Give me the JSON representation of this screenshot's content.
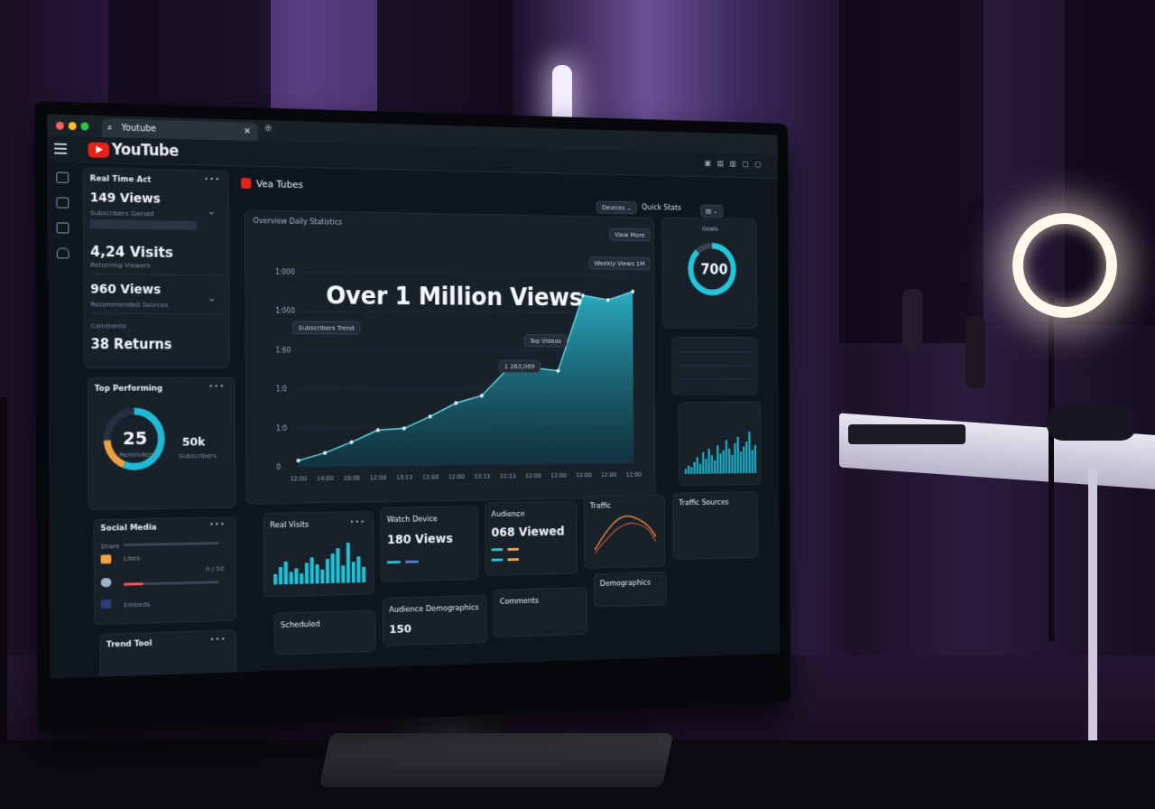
{
  "browser": {
    "tab_title": "Youtube",
    "tab_close": "✕"
  },
  "header": {
    "logo_text": "YouTube"
  },
  "left_panel": {
    "title": "Real Time Act",
    "stats": [
      {
        "value": "149 Views",
        "caption": "Subscribers Gained"
      },
      {
        "value": "4,24 Visits",
        "caption": "Returning Viewers"
      },
      {
        "value": "960 Views",
        "caption": "Recommended Sources"
      },
      {
        "value": "38 Returns",
        "caption": "Comments"
      }
    ]
  },
  "top_performing": {
    "title": "Top Performing",
    "gauge_value": "25",
    "gauge_caption": "Reminders",
    "side_value": "50k",
    "side_caption": "Subscribers",
    "gauge_fraction": 0.72
  },
  "social_panel": {
    "title": "Social Media",
    "items": [
      "Share",
      "Likes",
      "Embeds"
    ],
    "value": "0 / 50"
  },
  "trend_panel": {
    "title": "Trend Tool"
  },
  "main": {
    "title": "Vea Tubes",
    "dropdown_label": "Devices",
    "top_right_label": "Quick Stats",
    "chart_header": "Overview Daily Statistics",
    "chart_button": "View More",
    "headline": "Over 1 Million Views",
    "tooltips": {
      "peak": "Weekly Views 1M",
      "mid": "Top Videos",
      "point": "1 263,069",
      "left": "Subscribers Trend"
    }
  },
  "ring_panel": {
    "label": "Goals",
    "value": "700",
    "fraction": 0.88
  },
  "bottom_cards": {
    "real_time": {
      "title": "Real Visits"
    },
    "watch_time": {
      "title": "Watch Device",
      "value": "180 Views"
    },
    "audience": {
      "title": "Audience",
      "value": "068 Viewed"
    },
    "traffic": {
      "title": "Traffic"
    },
    "demographics": {
      "title": "Demographics"
    },
    "audience_chip": {
      "title": "Audience Demographics",
      "value": "150"
    },
    "scheduled": {
      "title": "Scheduled"
    },
    "comments": {
      "title": "Comments"
    },
    "right_table": {
      "title": "Traffic Sources"
    }
  },
  "chart_data": {
    "type": "area",
    "title": "Over 1 Million Views",
    "x": [
      "12:00",
      "14:00",
      "10:00",
      "12:00",
      "13:13",
      "12:00",
      "12:00",
      "13:13",
      "12:13",
      "12:00",
      "12:00",
      "12:00",
      "12:00",
      "12:00"
    ],
    "y_ticks": [
      "0",
      "1:0",
      "1:0",
      "1:60",
      "1:000",
      "1:000"
    ],
    "series": [
      {
        "values": [
          40,
          90,
          160,
          240,
          250,
          330,
          420,
          470,
          650,
          660,
          640,
          1160,
          1130,
          1190
        ]
      }
    ],
    "ylim": [
      0,
      1300
    ],
    "color": "#2bb3c8"
  }
}
